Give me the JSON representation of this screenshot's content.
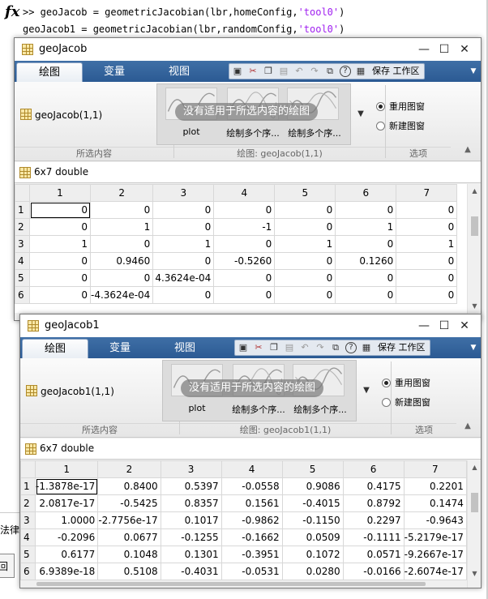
{
  "command_window": {
    "fx": "fx",
    "line1_prefix": ">> geoJacob = geometricJacobian(lbr,homeConfig,",
    "line1_str": "'tool0'",
    "line1_suffix": ")",
    "line2_prefix": "geoJacob1 = geometricJacobian(lbr,randomConfig,",
    "line2_str": "'tool0'",
    "line2_suffix": ")",
    "left_fragment_1": "法律",
    "left_fragment_2": "回"
  },
  "ribbon_common": {
    "tabs": [
      "绘图",
      "变量",
      "视图"
    ],
    "save_workspace": "保存 工作区",
    "no_plot_text": "没有适用于所选内容的绘图",
    "plot_labels": [
      "plot",
      "绘制多个序...",
      "绘制多个序..."
    ],
    "reuse_figure": "重用图窗",
    "new_figure": "新建图窗",
    "section_selection": "所选内容",
    "section_options": "选项"
  },
  "windows": [
    {
      "title": "geoJacob",
      "selection_name": "geoJacob(1,1)",
      "plot_section": "绘图: geoJacob(1,1)",
      "size_label": "6x7 double",
      "col_headers": [
        "1",
        "2",
        "3",
        "4",
        "5",
        "6",
        "7"
      ],
      "rows": [
        {
          "h": "1",
          "c": [
            "0",
            "0",
            "0",
            "0",
            "0",
            "0",
            "0"
          ]
        },
        {
          "h": "2",
          "c": [
            "0",
            "1",
            "0",
            "-1",
            "0",
            "1",
            "0"
          ]
        },
        {
          "h": "3",
          "c": [
            "1",
            "0",
            "1",
            "0",
            "1",
            "0",
            "1"
          ]
        },
        {
          "h": "4",
          "c": [
            "0",
            "0.9460",
            "0",
            "-0.5260",
            "0",
            "0.1260",
            "0"
          ]
        },
        {
          "h": "5",
          "c": [
            "0",
            "0",
            "4.3624e-04",
            "0",
            "0",
            "0",
            "0"
          ]
        },
        {
          "h": "6",
          "c": [
            "0",
            "-4.3624e-04",
            "0",
            "0",
            "0",
            "0",
            "0"
          ]
        }
      ]
    },
    {
      "title": "geoJacob1",
      "selection_name": "geoJacob1(1,1)",
      "plot_section": "绘图: geoJacob1(1,1)",
      "size_label": "6x7 double",
      "col_headers": [
        "1",
        "2",
        "3",
        "4",
        "5",
        "6",
        "7"
      ],
      "rows": [
        {
          "h": "1",
          "c": [
            "-1.3878e-17",
            "0.8400",
            "0.5397",
            "-0.0558",
            "0.9086",
            "0.4175",
            "0.2201"
          ]
        },
        {
          "h": "2",
          "c": [
            "2.0817e-17",
            "-0.5425",
            "0.8357",
            "0.1561",
            "-0.4015",
            "0.8792",
            "0.1474"
          ]
        },
        {
          "h": "3",
          "c": [
            "1.0000",
            "-2.7756e-17",
            "0.1017",
            "-0.9862",
            "-0.1150",
            "0.2297",
            "-0.9643"
          ]
        },
        {
          "h": "4",
          "c": [
            "-0.2096",
            "0.0677",
            "-0.1255",
            "-0.1662",
            "0.0509",
            "-0.1111",
            "-5.2179e-17"
          ]
        },
        {
          "h": "5",
          "c": [
            "0.6177",
            "0.1048",
            "0.1301",
            "-0.3951",
            "0.1072",
            "0.0571",
            "-9.2667e-17"
          ]
        },
        {
          "h": "6",
          "c": [
            "6.9389e-18",
            "0.5108",
            "-0.4031",
            "-0.0531",
            "0.0280",
            "-0.0166",
            "-2.6074e-17"
          ]
        }
      ]
    }
  ],
  "icons": {
    "close": "✕",
    "maximize": "☐",
    "minimize": "—",
    "dropdown": "▼",
    "scroll_up": "▲",
    "scroll_down": "▼",
    "collapse": "▲"
  }
}
